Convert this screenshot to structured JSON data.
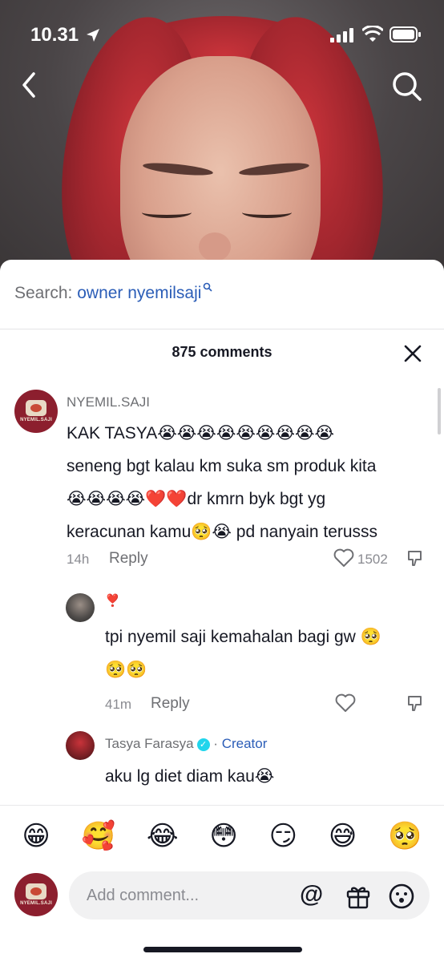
{
  "status": {
    "time": "10.31"
  },
  "search": {
    "label": "Search:",
    "query": "owner nyemilsaji"
  },
  "comments_header": {
    "count_label": "875 comments"
  },
  "comments": [
    {
      "username": "NYEMIL.SAJI",
      "avatar_text": "NYEMIL.SAJI",
      "lines": [
        "KAK TASYA😭😭😭😭😭😭😭😭😭",
        "seneng bgt kalau km suka sm produk kita",
        "😭😭😭😭❤️❤️dr kmrn byk bgt yg",
        "keracunan kamu🥺😭 pd nanyain terusss"
      ],
      "time": "14h",
      "reply_label": "Reply",
      "likes": "1502"
    },
    {
      "username": "❣️",
      "lines": [
        "tpi nyemil saji kemahalan bagi gw 🥺",
        "🥺🥺"
      ],
      "time": "41m",
      "reply_label": "Reply"
    },
    {
      "username": "Tasya Farasya",
      "creator_label": "Creator",
      "verified_mark": "✓",
      "dot": "·",
      "lines": [
        "aku lg diet diam kau😭"
      ]
    }
  ],
  "emoji_bar": [
    "😁",
    "🥰",
    "😂",
    "😳",
    "😏",
    "😅",
    "🥺"
  ],
  "composer": {
    "placeholder": "Add comment...",
    "at": "@",
    "avatar_text": "NYEMIL.SAJI"
  },
  "colors": {
    "link": "#2b5db7",
    "brand": "#8c1f2e",
    "muted": "#8a8b91"
  }
}
